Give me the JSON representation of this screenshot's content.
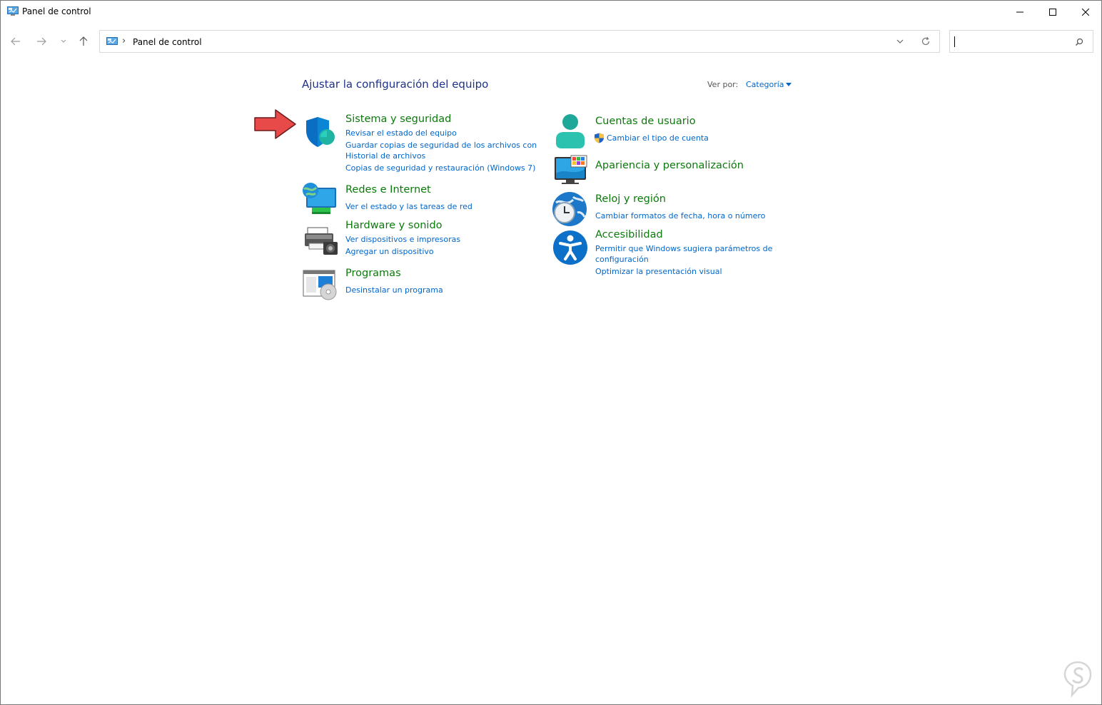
{
  "window": {
    "title": "Panel de control"
  },
  "address_bar": {
    "separator": "›",
    "path": "Panel de control"
  },
  "content": {
    "heading": "Ajustar la configuración del equipo",
    "view_by_label": "Ver por:",
    "view_by_value": "Categoría"
  },
  "categories": [
    {
      "icon": "shield-icon",
      "title": "Sistema y seguridad",
      "links": [
        "Revisar el estado del equipo",
        "Guardar copias de seguridad de los archivos con",
        "Historial de archivos",
        "Copias de seguridad y restauración (Windows 7)"
      ]
    },
    {
      "icon": "network-globe-icon",
      "title": "Redes e Internet",
      "links": [
        "Ver el estado y las tareas de red"
      ]
    },
    {
      "icon": "printer-icon",
      "title": "Hardware y sonido",
      "links": [
        "Ver dispositivos e impresoras",
        "Agregar un dispositivo"
      ]
    },
    {
      "icon": "programs-icon",
      "title": "Programas",
      "links": [
        "Desinstalar un programa"
      ]
    },
    {
      "icon": "user-icon",
      "title": "Cuentas de usuario",
      "links": [
        "Cambiar el tipo de cuenta"
      ]
    },
    {
      "icon": "monitor-palette-icon",
      "title": "Apariencia y personalización",
      "links": []
    },
    {
      "icon": "clock-globe-icon",
      "title": "Reloj y región",
      "links": [
        "Cambiar formatos de fecha, hora o número"
      ]
    },
    {
      "icon": "accessibility-icon",
      "title": "Accesibilidad",
      "links": [
        "Permitir que Windows sugiera parámetros de",
        "configuración",
        "Optimizar la presentación visual"
      ]
    }
  ],
  "colors": {
    "title_green": "#0b7a0b",
    "link_blue": "#0066cc",
    "heading_blue": "#1e3287",
    "annotation_arrow": "#e84a4a"
  }
}
